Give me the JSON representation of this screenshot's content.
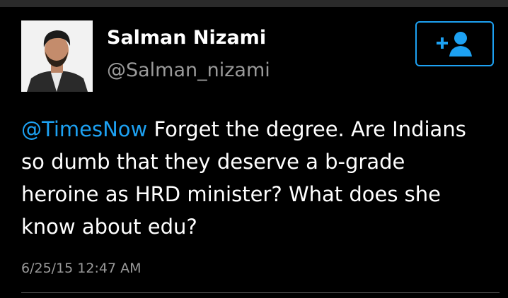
{
  "tweet": {
    "author_name": "Salman Nizami",
    "author_handle": "@Salman_nizami",
    "mention": "@TimesNow",
    "body": " Forget the degree. Are Indians so dumb that they deserve a b-grade heroine as HRD minister? What does she know about edu?",
    "timestamp": "6/25/15 12:47 AM"
  },
  "follow_button": {
    "icon": "add-user-icon"
  },
  "colors": {
    "background": "#000000",
    "text": "#ffffff",
    "secondary_text": "#9a9a9a",
    "accent": "#1da1f2"
  }
}
